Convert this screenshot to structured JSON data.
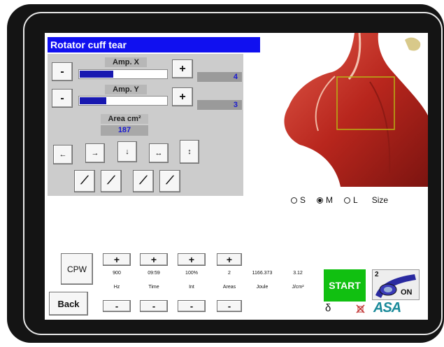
{
  "app": {
    "title": "Rotator cuff tear"
  },
  "amp_x": {
    "label": "Amp. X",
    "value": "4",
    "minus": "-",
    "plus": "+",
    "fill": 0.38
  },
  "amp_y": {
    "label": "Amp. Y",
    "value": "3",
    "minus": "-",
    "plus": "+",
    "fill": 0.3
  },
  "area": {
    "label": "Area cm²",
    "value": "187"
  },
  "direction_buttons": [
    {
      "glyph": "←",
      "icon": "arrow-left-icon"
    },
    {
      "glyph": "→",
      "icon": "arrow-right-icon"
    },
    {
      "glyph": "↓",
      "icon": "arrow-down-icon"
    },
    {
      "glyph": "↔",
      "icon": "arrow-horizontal-icon"
    },
    {
      "glyph": "↕",
      "icon": "arrow-vertical-icon"
    }
  ],
  "applicator_buttons": [
    {
      "glyph": "⟋",
      "icon": "applicator-angle-icon"
    },
    {
      "glyph": "⟋",
      "icon": "applicator-tilt-icon"
    },
    {
      "glyph": "⟋",
      "icon": "applicator-up-icon"
    },
    {
      "glyph": "⟋",
      "icon": "applicator-down-icon"
    }
  ],
  "size": {
    "options": [
      "S",
      "M",
      "L"
    ],
    "selected": "M",
    "label": "Size"
  },
  "cpw": {
    "label": "CPW"
  },
  "back": {
    "label": "Back"
  },
  "params": [
    {
      "value": "900",
      "unit": "Hz"
    },
    {
      "value": "09:59",
      "unit": "Time"
    },
    {
      "value": "100%",
      "unit": "Int"
    },
    {
      "value": "2",
      "unit": "Areas"
    }
  ],
  "stepper": {
    "plus": "+",
    "minus": "-"
  },
  "joule": {
    "value": "1166.373",
    "unit": "Joule"
  },
  "energy": {
    "value": "3.12",
    "unit": "J/cm²"
  },
  "start": {
    "label": "START"
  },
  "applicator_status": {
    "number": "2",
    "state": "ON"
  },
  "footer": {
    "delta": "δ",
    "brand": "ASA"
  },
  "colors": {
    "title_bar": "#1010f0",
    "start": "#11c011",
    "values": "#1a1ad0"
  }
}
